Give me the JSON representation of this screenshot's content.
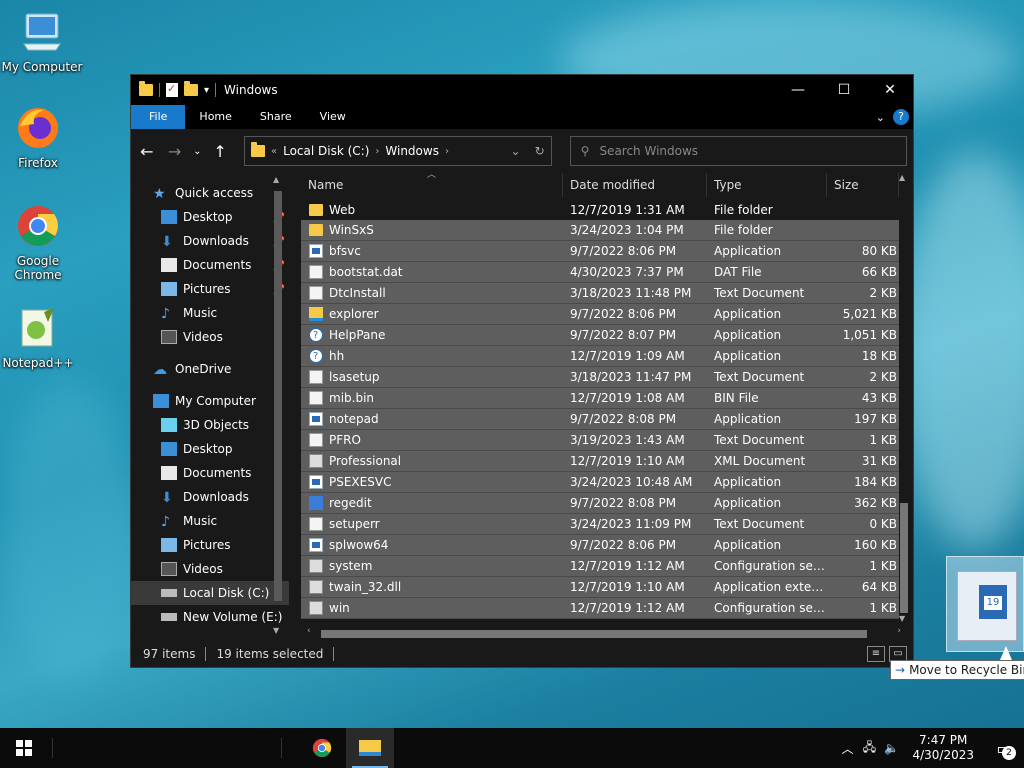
{
  "desktop": {
    "icons": [
      {
        "label": "My Computer"
      },
      {
        "label": "Firefox"
      },
      {
        "label": "Google Chrome"
      },
      {
        "label": "Notepad++"
      },
      {
        "label": "Recycle Bin"
      }
    ]
  },
  "window": {
    "title": "Windows",
    "ribbon_tabs": [
      "File",
      "Home",
      "Share",
      "View"
    ],
    "address": {
      "crumbs": [
        "Local Disk (C:)",
        "Windows"
      ]
    },
    "search_placeholder": "Search Windows",
    "columns": [
      "Name",
      "Date modified",
      "Type",
      "Size"
    ],
    "nav": {
      "quick_access": "Quick access",
      "quick_items": [
        "Desktop",
        "Downloads",
        "Documents",
        "Pictures",
        "Music",
        "Videos"
      ],
      "onedrive": "OneDrive",
      "my_computer": "My Computer",
      "pc_items": [
        "3D Objects",
        "Desktop",
        "Documents",
        "Downloads",
        "Music",
        "Pictures",
        "Videos",
        "Local Disk (C:)",
        "New Volume (E:)"
      ]
    },
    "files": [
      {
        "name": "Web",
        "date": "12/7/2019 1:31 AM",
        "type": "File folder",
        "size": "",
        "icon": "folder",
        "selected": false
      },
      {
        "name": "WinSxS",
        "date": "3/24/2023 1:04 PM",
        "type": "File folder",
        "size": "",
        "icon": "folder",
        "selected": true
      },
      {
        "name": "bfsvc",
        "date": "9/7/2022 8:06 PM",
        "type": "Application",
        "size": "80 KB",
        "icon": "app",
        "selected": true
      },
      {
        "name": "bootstat.dat",
        "date": "4/30/2023 7:37 PM",
        "type": "DAT File",
        "size": "66 KB",
        "icon": "doc",
        "selected": true
      },
      {
        "name": "DtcInstall",
        "date": "3/18/2023 11:48 PM",
        "type": "Text Document",
        "size": "2 KB",
        "icon": "doc",
        "selected": true
      },
      {
        "name": "explorer",
        "date": "9/7/2022 8:06 PM",
        "type": "Application",
        "size": "5,021 KB",
        "icon": "expl",
        "selected": true
      },
      {
        "name": "HelpPane",
        "date": "9/7/2022 8:07 PM",
        "type": "Application",
        "size": "1,051 KB",
        "icon": "help",
        "selected": true
      },
      {
        "name": "hh",
        "date": "12/7/2019 1:09 AM",
        "type": "Application",
        "size": "18 KB",
        "icon": "help",
        "selected": true
      },
      {
        "name": "lsasetup",
        "date": "3/18/2023 11:47 PM",
        "type": "Text Document",
        "size": "2 KB",
        "icon": "doc",
        "selected": true
      },
      {
        "name": "mib.bin",
        "date": "12/7/2019 1:08 AM",
        "type": "BIN File",
        "size": "43 KB",
        "icon": "doc",
        "selected": true
      },
      {
        "name": "notepad",
        "date": "9/7/2022 8:08 PM",
        "type": "Application",
        "size": "197 KB",
        "icon": "app",
        "selected": true
      },
      {
        "name": "PFRO",
        "date": "3/19/2023 1:43 AM",
        "type": "Text Document",
        "size": "1 KB",
        "icon": "doc",
        "selected": true
      },
      {
        "name": "Professional",
        "date": "12/7/2019 1:10 AM",
        "type": "XML Document",
        "size": "31 KB",
        "icon": "cfg",
        "selected": true
      },
      {
        "name": "PSEXESVC",
        "date": "3/24/2023 10:48 AM",
        "type": "Application",
        "size": "184 KB",
        "icon": "app",
        "selected": true
      },
      {
        "name": "regedit",
        "date": "9/7/2022 8:08 PM",
        "type": "Application",
        "size": "362 KB",
        "icon": "reg",
        "selected": true
      },
      {
        "name": "setuperr",
        "date": "3/24/2023 11:09 PM",
        "type": "Text Document",
        "size": "0 KB",
        "icon": "doc",
        "selected": true
      },
      {
        "name": "splwow64",
        "date": "9/7/2022 8:06 PM",
        "type": "Application",
        "size": "160 KB",
        "icon": "app",
        "selected": true
      },
      {
        "name": "system",
        "date": "12/7/2019 1:12 AM",
        "type": "Configuration sett...",
        "size": "1 KB",
        "icon": "cfg",
        "selected": true
      },
      {
        "name": "twain_32.dll",
        "date": "12/7/2019 1:10 AM",
        "type": "Application exten...",
        "size": "64 KB",
        "icon": "cfg",
        "selected": true
      },
      {
        "name": "win",
        "date": "12/7/2019 1:12 AM",
        "type": "Configuration sett...",
        "size": "1 KB",
        "icon": "cfg",
        "selected": true
      }
    ],
    "status": {
      "items": "97 items",
      "selected": "19 items selected"
    }
  },
  "drag": {
    "tooltip": "Move to Recycle Bin",
    "calendar_day": "19"
  },
  "taskbar": {
    "time": "7:47 PM",
    "date": "4/30/2023",
    "notifications": "2"
  },
  "colors": {
    "accent": "#1979ca",
    "selection": "#5e5e5e",
    "folder": "#f7c948"
  }
}
